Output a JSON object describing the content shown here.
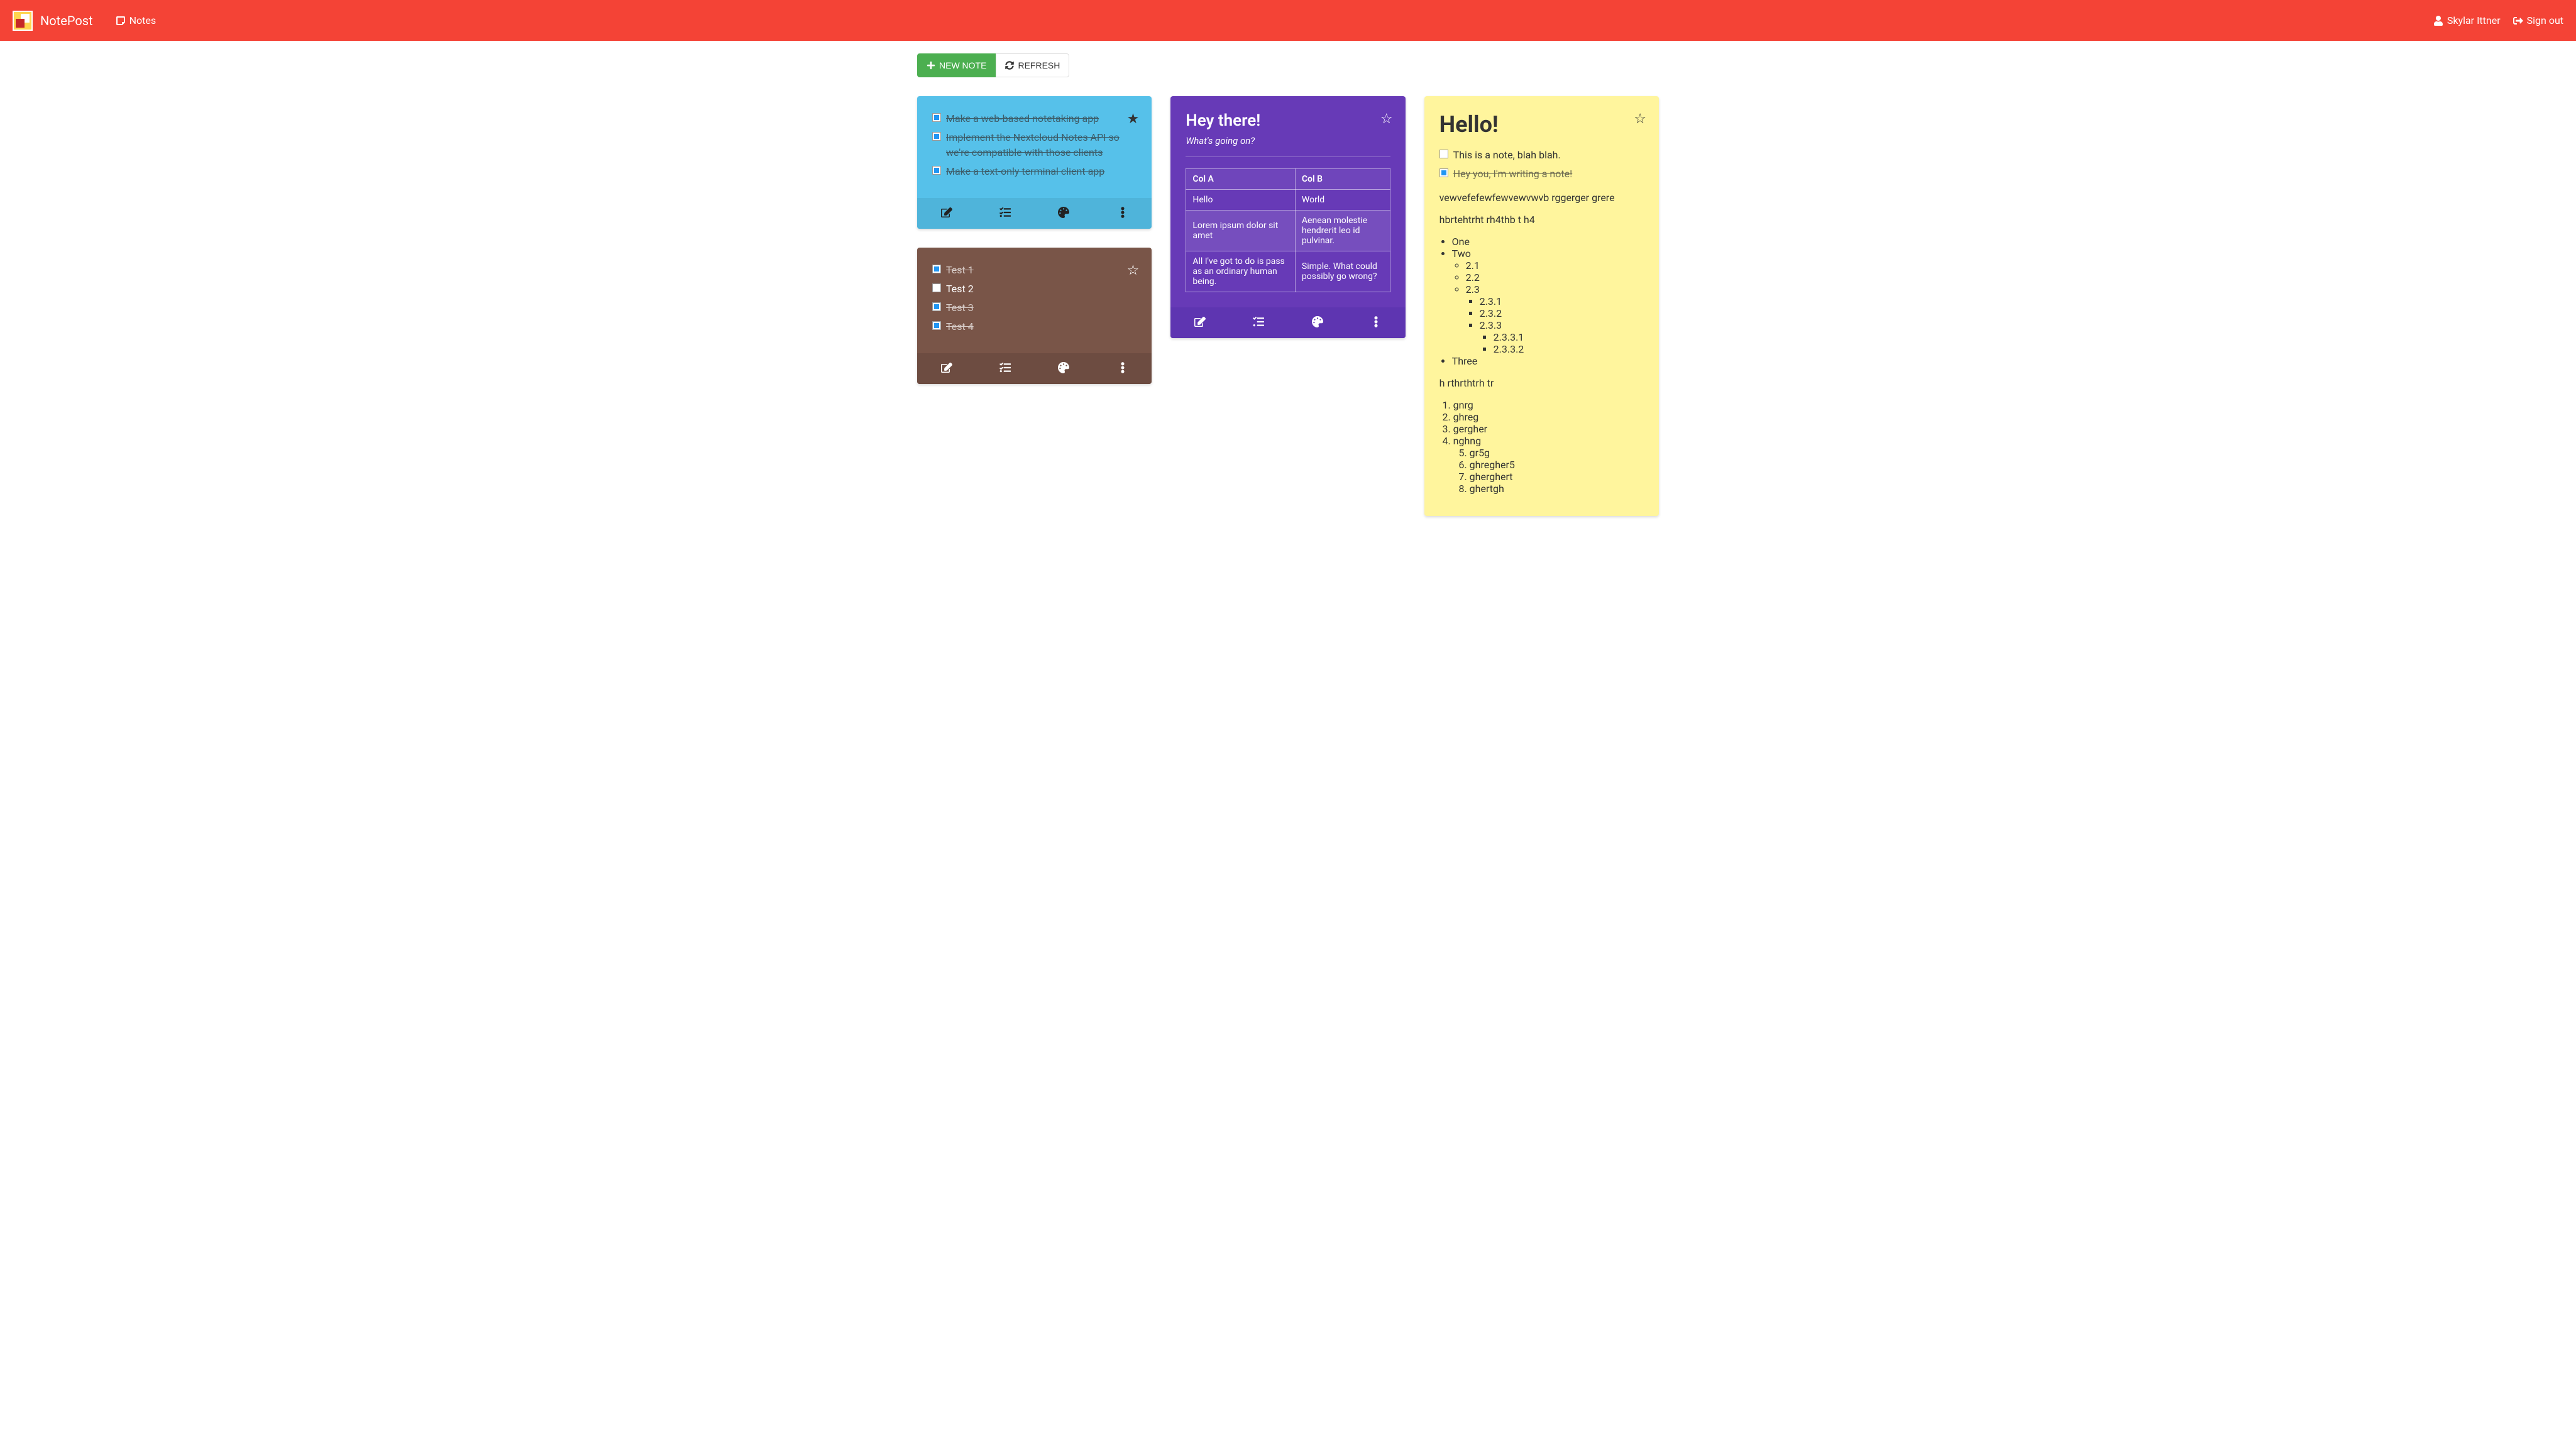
{
  "header": {
    "brand": "NotePost",
    "nav_notes": "Notes",
    "user": "Skylar Ittner",
    "signout": "Sign out"
  },
  "toolbar": {
    "new_note": "NEW NOTE",
    "refresh": "REFRESH"
  },
  "note_blue": {
    "items": [
      {
        "text": "Make a web-based notetaking app",
        "checked": true
      },
      {
        "text": "Implement the Nextcloud Notes API so we're compatible with those clients",
        "checked": true
      },
      {
        "text": "Make a text-only terminal client app",
        "checked": true
      }
    ],
    "favorite": true
  },
  "note_brown": {
    "items": [
      {
        "text": "Test 1",
        "checked": true
      },
      {
        "text": "Test 2",
        "checked": false
      },
      {
        "text": "Test 3",
        "checked": true
      },
      {
        "text": "Test 4",
        "checked": true
      }
    ],
    "favorite": false
  },
  "note_purple": {
    "title": "Hey there!",
    "subtitle": "What's going on?",
    "table": {
      "headers": [
        "Col A",
        "Col B"
      ],
      "rows": [
        [
          "Hello",
          "World"
        ],
        [
          "Lorem ipsum dolor sit amet",
          "Aenean molestie hendrerit leo id pulvinar."
        ],
        [
          "All I've got to do is pass as an ordinary human being.",
          "Simple. What could possibly go wrong?"
        ]
      ]
    },
    "favorite": false
  },
  "note_yellow": {
    "title": "Hello!",
    "check1": {
      "text": "This is a note, blah blah.",
      "checked": false
    },
    "check2": {
      "text": "Hey you, I'm writing a note!",
      "checked": true
    },
    "para1": "vewvefefewfewvewvwvb rggerger grere",
    "para2": "hbrtehtrht rh4thb t h4",
    "bullets": {
      "a": "One",
      "b": "Two",
      "b1": "2.1",
      "b2": "2.2",
      "b3": "2.3",
      "b31": "2.3.1",
      "b32": "2.3.2",
      "b33": "2.3.3",
      "b331": "2.3.3.1",
      "b332": "2.3.3.2",
      "c": "Three"
    },
    "para3": "h rthrthtrh tr",
    "ol": {
      "1": "gnrg",
      "2": "ghreg",
      "3": "gergher",
      "4": "nghng",
      "5": "gr5g",
      "6": "ghregher5",
      "7": "gherghert",
      "8": "ghertgh"
    },
    "favorite": false
  }
}
